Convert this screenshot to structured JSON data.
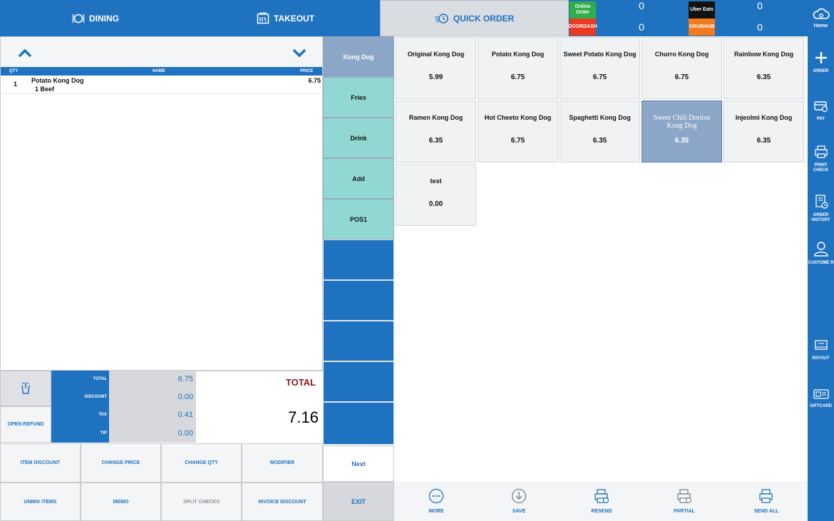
{
  "topbar": {
    "tabs": [
      {
        "label": "DINING",
        "icon": "dining-icon"
      },
      {
        "label": "TAKEOUT",
        "icon": "takeout-icon"
      },
      {
        "label": "QUICK ORDER",
        "icon": "quick-order-icon",
        "active": true
      }
    ],
    "delivery": [
      {
        "name": "Online Order",
        "count": "0",
        "color": "#2fae4a"
      },
      {
        "name": "DOORDASH",
        "count": "0",
        "color": "#ea3a23"
      },
      {
        "name": "Uber Eats",
        "count": "0",
        "color": "#111111"
      },
      {
        "name": "GRUBHUB",
        "count": "0",
        "color": "#f17b1d"
      }
    ],
    "home_label": "Home"
  },
  "order_list": {
    "headers": {
      "qty": "QTY",
      "name": "NAME",
      "price": "PRICE"
    },
    "rows": [
      {
        "qty": "1",
        "name": "Potato Kong Dog",
        "modifier": "1 Beef",
        "price": "6.75"
      }
    ]
  },
  "totals": {
    "labels": {
      "total": "TOTAL",
      "discount": "DISCOUNT",
      "tax": "TAX",
      "tip": "TIP"
    },
    "values": {
      "total": "6.75",
      "discount": "0.00",
      "tax": "0.41",
      "tip": "0.00"
    },
    "grand_total_label": "TOTAL",
    "grand_total": "7.16",
    "open_refund": "OPEN REFUND"
  },
  "actions": {
    "item_discount": "ITEM DISCOUNT",
    "change_price": "CHANGE PRICE",
    "change_qty": "CHANGE QTY",
    "modifier": "MODIFIER",
    "unmix_items": "UNMIX ITEMS",
    "memo": "MEMO",
    "split_checks": "SPLIT CHECKS",
    "invoice_discount": "INVOICE DISCOUNT"
  },
  "categories": [
    "Kong Dog",
    "Fries",
    "Drink",
    "Add",
    "POS1"
  ],
  "category_next": "Next",
  "category_exit": "EXIT",
  "menu_items": [
    {
      "name": "Original Kong Dog",
      "price": "5.99"
    },
    {
      "name": "Potato Kong Dog",
      "price": "6.75"
    },
    {
      "name": "Sweet Potato Kong Dog",
      "price": "6.75"
    },
    {
      "name": "Churro Kong Dog",
      "price": "6.75"
    },
    {
      "name": "Rainbow Kong Dog",
      "price": "6.35"
    },
    {
      "name": "Ramen Kong Dog",
      "price": "6.35"
    },
    {
      "name": "Hot Cheeto Kong Dog",
      "price": "6.75"
    },
    {
      "name": "Spaghetti Kong Dog",
      "price": "6.35"
    },
    {
      "name": "Sweet Chili Doritos Kong Dog",
      "price": "6.35",
      "selected": true
    },
    {
      "name": "Injeolmi Kong Dog",
      "price": "6.35"
    },
    {
      "name": "test",
      "price": "0.00"
    }
  ],
  "toolbar": {
    "more": "MORE",
    "save": "SAVE",
    "resend": "RESEND",
    "partial": "PARTIAL",
    "send_all": "SEND ALL"
  },
  "sidebar": {
    "order": "ORDER",
    "pay": "PAY",
    "print_check": "PRINT CHECK",
    "order_history": "ORDER HISTORY",
    "customer": "CUSTOME R",
    "payout": "PAYOUT",
    "giftcard": "GIFTCARD"
  },
  "colors": {
    "primary": "#1f72c0",
    "teal": "#92d8d2",
    "selected": "#8ca6c8",
    "total_red": "#8b1a1a"
  }
}
